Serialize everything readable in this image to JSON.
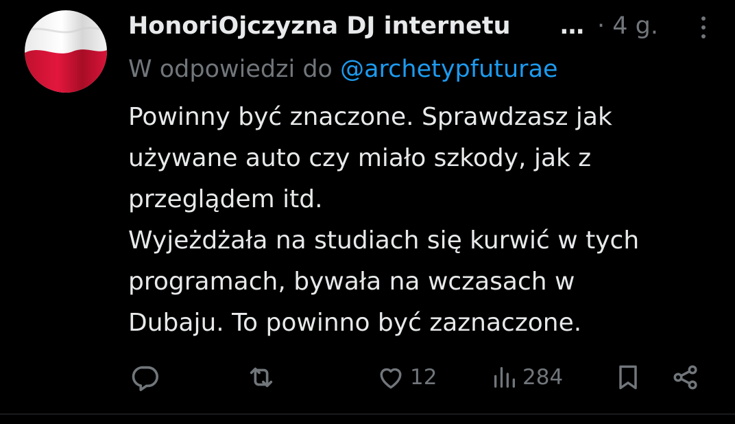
{
  "tweet": {
    "author_name": "HonoriOjczyzna DJ internetu",
    "name_ellipsis": "…",
    "meta": "· 4 g.",
    "reply_prefix": "W odpowiedzi do",
    "reply_handle": "@archetypfuturae",
    "body_lines": [
      "Powinny być znaczone. Sprawdzasz jak",
      "używane auto czy miało szkody,  jak z",
      "przeglądem itd.",
      "Wyjeżdżała na studiach się kurwić w tych",
      "programach, bywała na wczasach w",
      "Dubaju. To powinno być zaznaczone."
    ],
    "actions": {
      "reply_icon": "reply-icon",
      "retweet_icon": "retweet-icon",
      "like_icon": "heart-icon",
      "like_count": "12",
      "views_icon": "views-icon",
      "views_count": "284",
      "bookmark_icon": "bookmark-icon",
      "share_icon": "share-icon"
    }
  },
  "colors": {
    "background": "#000000",
    "text_primary": "#e7e9ea",
    "text_secondary": "#71767b",
    "accent_link": "#1d9bf0",
    "flag_red": "#dc143c",
    "flag_white": "#f4f4f4"
  }
}
